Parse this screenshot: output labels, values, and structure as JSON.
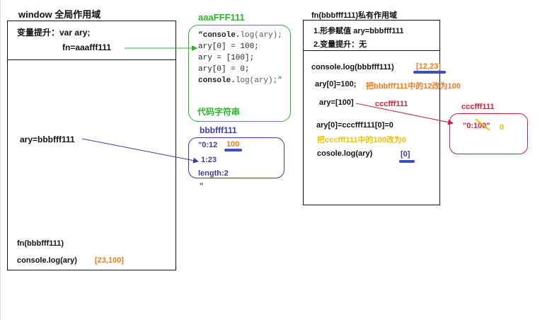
{
  "window_scope": {
    "title": "window 全局作用域",
    "hoist_line1": "变量提升：var ary;",
    "hoist_line2": "fn=aaafff111",
    "ary_assign": "ary=bbbfff111",
    "fn_call": "fn(bbbfff111)",
    "console_log": "console.log(ary)",
    "result": "[23,100]"
  },
  "code_heap": {
    "title": "aaaFFF111",
    "lines": [
      {
        "a": "“console.",
        "b": "log(ary);"
      },
      {
        "a": "ary[0] = 100;",
        "b": ""
      },
      {
        "a": "ary = [100];",
        "b": ""
      },
      {
        "a": "ary[0] = 0;",
        "b": ""
      },
      {
        "a": "console.",
        "b": "log(ary);”"
      }
    ],
    "label": "代码字符串"
  },
  "array_heap": {
    "title": "bbbfff111",
    "entry0_key": "\"0:12",
    "entry0_new": "100",
    "entry1": "1:23",
    "length": "length:2",
    "closing_quote": "\""
  },
  "fn_scope": {
    "title": "fn(bbbfff111)私有作用域",
    "step1": "1.形参赋值 ary=bbbfff111",
    "step2": "2.变量提升：无",
    "log1": "console.log(bbbfff111)",
    "log1_result": "[12,23]",
    "assign1": "ary[0]=100;",
    "assign1_note": "把bbbfff111中的12改为100",
    "assign2": "ary=[100]",
    "assign2_arrow_label": "cccfff111",
    "assign3": "ary[0]=cccfff111[0]=0",
    "assign3_note": "把cccfff111中的100改为0",
    "log2": "cosole.log(ary)",
    "log2_result": "[0]"
  },
  "ccc_heap": {
    "title": "cccfff111",
    "content": "\"0:100\"",
    "new_value": "0"
  },
  "colors": {
    "green": "#2bb32b",
    "navy": "#3a3aa8",
    "orange": "#f07a1e",
    "red": "#d0203a",
    "yellow": "#f0c000"
  }
}
